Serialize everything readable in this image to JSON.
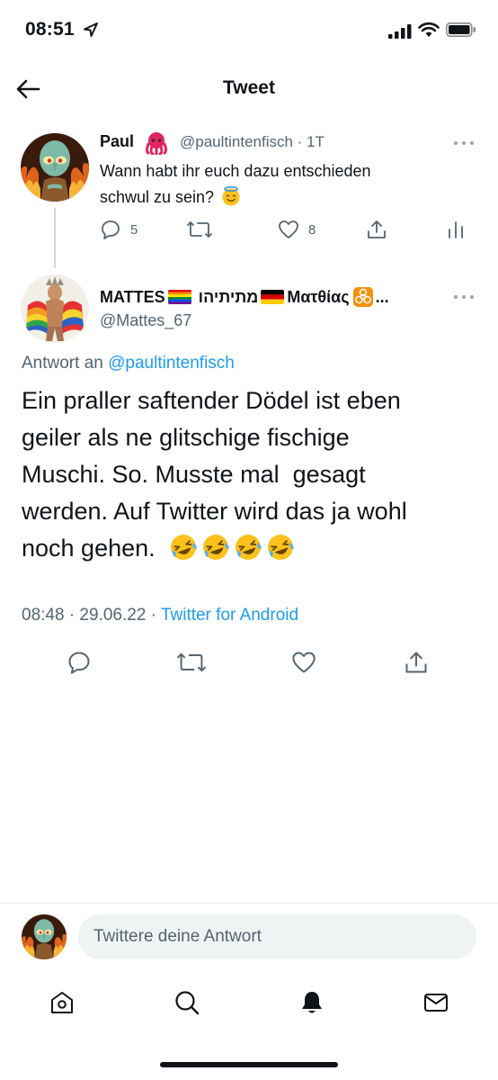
{
  "status_bar": {
    "time": "08:51"
  },
  "header": {
    "title": "Tweet"
  },
  "parent_tweet": {
    "name": "Paul",
    "handle": "@paultintenfisch · 1T",
    "text_line1": "Wann habt ihr euch dazu entschieden",
    "text_line2": "schwul zu sein?",
    "reply_count": "5",
    "like_count": "8"
  },
  "main_tweet": {
    "name_part1": "MATTES",
    "name_part2": "מתיתיהו",
    "name_part3": "Ματθίας",
    "name_ellipsis": "...",
    "handle": "@Mattes_67",
    "reply_prefix": "Antwort an",
    "reply_handle": "@paultintenfisch",
    "text_line1": "Ein praller saftender Dödel ist eben",
    "text_line2": "geiler als ne glitschige fischige",
    "text_line3": "Muschi. So. Musste mal  gesagt",
    "text_line4": "werden. Auf Twitter wird das ja wohl",
    "text_line5": "noch gehen.",
    "timestamp": "08:48 · 29.06.22 · ",
    "source": "Twitter for Android"
  },
  "reply_bar": {
    "placeholder": "Twittere deine Antwort"
  },
  "colors": {
    "accent": "#1d9bf0",
    "secondary_text": "#536471",
    "primary_text": "#0f1419"
  },
  "icons": [
    "location-arrow-icon",
    "signal-icon",
    "wifi-icon",
    "battery-icon",
    "back-arrow-icon",
    "octopus-emoji-icon",
    "halo-emoji-icon",
    "more-icon",
    "reply-icon",
    "retweet-icon",
    "like-icon",
    "share-icon",
    "analytics-icon",
    "rainbow-flag-icon",
    "germany-flag-icon",
    "biohazard-icon",
    "laughing-emoji-icon",
    "home-icon",
    "search-icon",
    "bell-icon",
    "mail-icon"
  ]
}
